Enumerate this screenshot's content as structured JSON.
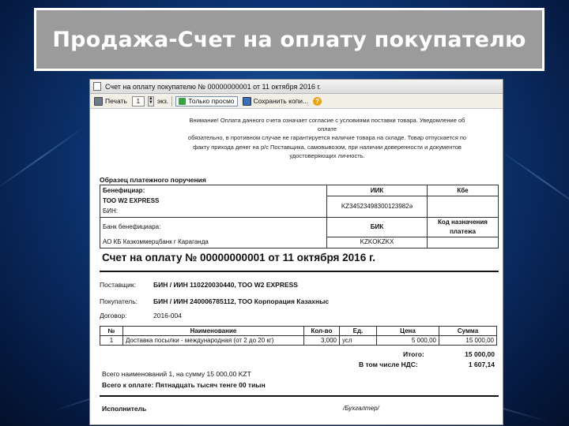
{
  "slide": {
    "title": "Продажа-Счет на оплату покупателю"
  },
  "window": {
    "title": "Счет на оплату покупателю № 00000000001 от 11 октября 2016 г."
  },
  "toolbar": {
    "print_label": "Печать",
    "copies_value": "1",
    "copies_suffix": "экз.",
    "view_mode_label": "Только просмо",
    "save_label": "Сохранить копи..."
  },
  "document": {
    "warning_lines": [
      "Внимание! Оплата данного счета означает согласие с условиями поставки товара. Уведомление об",
      "оплате",
      "обязательно, в противном случае не гарантируется наличие товара на складе. Товар отпускается по",
      "факту прихода денег на р/с Поставщика, самовывозом, при наличии доверенности и документов",
      "удостоверяющих личность."
    ],
    "sample_title": "Образец платежного поручения",
    "payment": {
      "beneficiary_label": "Бенефициар:",
      "iik_label": "ИИК",
      "kbe_label": "Кбе",
      "beneficiary_name": "ТОО W2 EXPRESS",
      "iik_value": "KZ34523498300123982ә",
      "bin_line": "БИН:",
      "bank_label": "Банк бенефициара:",
      "bik_label": "БИК",
      "purpose_label": "Код назначения платежа",
      "bank_name": "АО КБ Казкоммерцбанк г Караганда",
      "bik_value": "KZKOKZKX"
    },
    "invoice_title": "Счет на оплату № 00000000001 от 11 октября 2016 г.",
    "supplier_label": "Поставщик:",
    "supplier_value": "БИН / ИИН 110220030440, ТОО W2 EXPRESS",
    "buyer_label": "Покупатель:",
    "buyer_value": "БИН / ИИН 240006785112, ТОО Корпорация Казахныс",
    "contract_label": "Договор:",
    "contract_value": "2016-004",
    "items_headers": [
      "№",
      "Наименование",
      "Кол-во",
      "Ед.",
      "Цена",
      "Сумма"
    ],
    "items": [
      {
        "no": "1",
        "name": "Доставка посылки - международная (от 2 до 20 кг)",
        "qty": "3,000",
        "unit": "усл",
        "price": "5 000,00",
        "sum": "15 000,00"
      }
    ],
    "total_label": "Итого:",
    "total_value": "15 000,00",
    "vat_label": "В том числе НДС:",
    "vat_value": "1 607,14",
    "count_line": "Всего наименований 1, на сумму 15 000,00 KZT",
    "pay_label": "Всего к оплате:",
    "pay_words": "Пятнадцать тысяч тенге 00 тиын",
    "signer_label": "Исполнитель",
    "signer_role": "/Бухгалтер/"
  }
}
